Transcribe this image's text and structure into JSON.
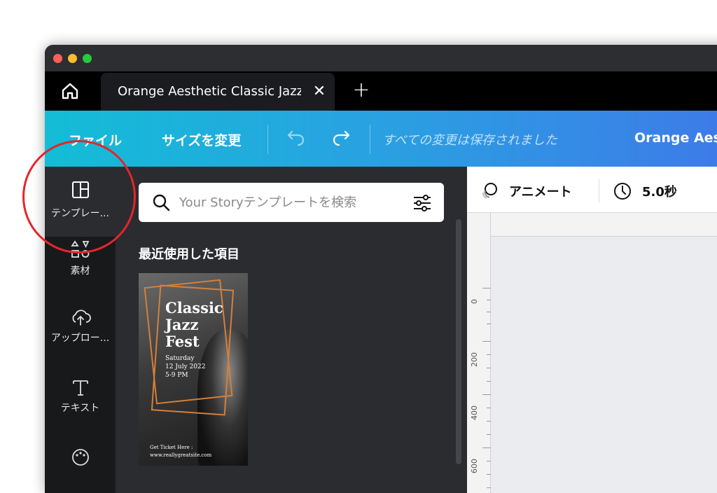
{
  "tab": {
    "title": "Orange Aesthetic Classic Jazz Fest"
  },
  "toolbar": {
    "file_label": "ファイル",
    "resize_label": "サイズを変更",
    "status": "すべての変更は保存されました",
    "doc_title": "Orange Aest"
  },
  "siderail": {
    "items": [
      {
        "label": "テンプレー...",
        "icon": "templates-icon"
      },
      {
        "label": "素材",
        "icon": "elements-icon"
      },
      {
        "label": "アップロー...",
        "icon": "upload-icon"
      },
      {
        "label": "テキスト",
        "icon": "text-icon"
      },
      {
        "label": "",
        "icon": "palette-icon"
      }
    ]
  },
  "panel": {
    "search_placeholder": "Your Storyテンプレートを検索",
    "section_title": "最近使用した項目",
    "thumbnail": {
      "title": "Classic\nJazz\nFest",
      "sub": "Saturday\n12 July 2022\n5-9 PM",
      "foot": "Get Ticket Here :\nwww.reallygreatsite.com"
    }
  },
  "canvas_toolbar": {
    "animate_label": "アニメート",
    "duration_label": "5.0秒"
  },
  "ruler": {
    "labels": [
      "0",
      "200",
      "400",
      "600"
    ]
  },
  "colors": {
    "accent_start": "#13bdd6",
    "accent_end": "#3e7ae8",
    "highlight": "#e3262b",
    "template_frame": "#d4803a"
  }
}
